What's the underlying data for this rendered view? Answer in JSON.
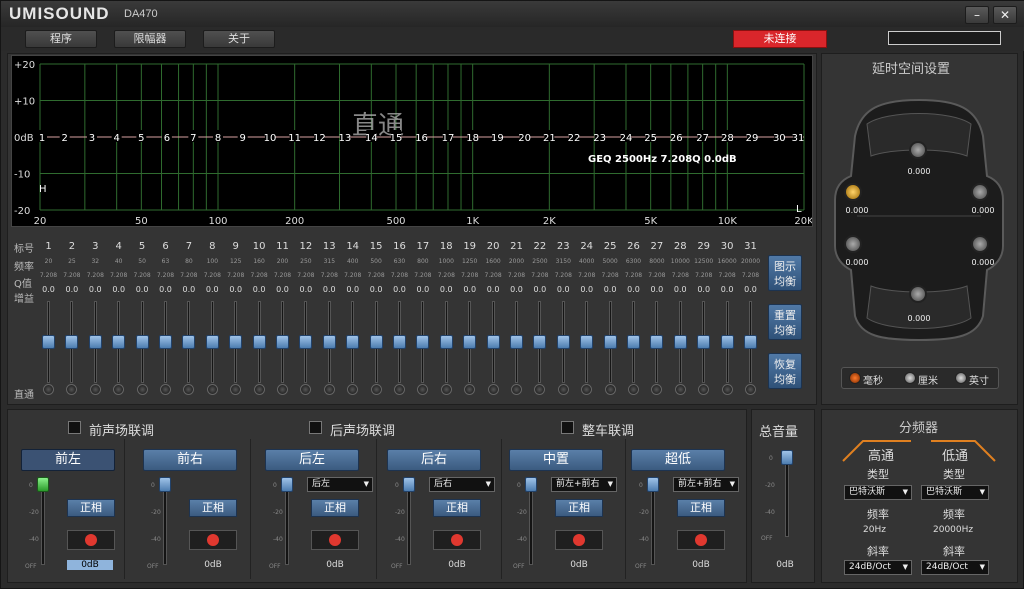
{
  "app": {
    "logo": "UMISOUND",
    "model": "DA470",
    "minimize": "–",
    "close": "✕"
  },
  "menu": [
    "程序",
    "限幅器",
    "关于"
  ],
  "status": {
    "connection": "未连接"
  },
  "graph": {
    "y_labels": [
      "+20",
      "+10",
      "0dB",
      "-10",
      "-20"
    ],
    "x_labels": [
      "20",
      "50",
      "100",
      "200",
      "500",
      "1K",
      "2K",
      "5K",
      "10K",
      "20K"
    ],
    "band_numbers": [
      "1",
      "2",
      "3",
      "4",
      "5",
      "6",
      "7",
      "8",
      "9",
      "10",
      "11",
      "12",
      "13",
      "14",
      "15",
      "16",
      "17",
      "18",
      "19",
      "20",
      "21",
      "22",
      "23",
      "24",
      "25",
      "26",
      "27",
      "28",
      "29",
      "30",
      "31"
    ],
    "mode_text": "直通",
    "info": "GEQ 2500Hz 7.208Q 0.0dB",
    "hp_marker": "H",
    "lp_marker": "L"
  },
  "eq": {
    "row_labels": {
      "index": "标号",
      "freq": "频率",
      "q": "Q值",
      "gain": "增益",
      "bypass": "直通"
    },
    "bands": [
      {
        "n": "1",
        "f": "20",
        "q": "7.208",
        "g": "0.0"
      },
      {
        "n": "2",
        "f": "25",
        "q": "7.208",
        "g": "0.0"
      },
      {
        "n": "3",
        "f": "32",
        "q": "7.208",
        "g": "0.0"
      },
      {
        "n": "4",
        "f": "40",
        "q": "7.208",
        "g": "0.0"
      },
      {
        "n": "5",
        "f": "50",
        "q": "7.208",
        "g": "0.0"
      },
      {
        "n": "6",
        "f": "63",
        "q": "7.208",
        "g": "0.0"
      },
      {
        "n": "7",
        "f": "80",
        "q": "7.208",
        "g": "0.0"
      },
      {
        "n": "8",
        "f": "100",
        "q": "7.208",
        "g": "0.0"
      },
      {
        "n": "9",
        "f": "125",
        "q": "7.208",
        "g": "0.0"
      },
      {
        "n": "10",
        "f": "160",
        "q": "7.208",
        "g": "0.0"
      },
      {
        "n": "11",
        "f": "200",
        "q": "7.208",
        "g": "0.0"
      },
      {
        "n": "12",
        "f": "250",
        "q": "7.208",
        "g": "0.0"
      },
      {
        "n": "13",
        "f": "315",
        "q": "7.208",
        "g": "0.0"
      },
      {
        "n": "14",
        "f": "400",
        "q": "7.208",
        "g": "0.0"
      },
      {
        "n": "15",
        "f": "500",
        "q": "7.208",
        "g": "0.0"
      },
      {
        "n": "16",
        "f": "630",
        "q": "7.208",
        "g": "0.0"
      },
      {
        "n": "17",
        "f": "800",
        "q": "7.208",
        "g": "0.0"
      },
      {
        "n": "18",
        "f": "1000",
        "q": "7.208",
        "g": "0.0"
      },
      {
        "n": "19",
        "f": "1250",
        "q": "7.208",
        "g": "0.0"
      },
      {
        "n": "20",
        "f": "1600",
        "q": "7.208",
        "g": "0.0"
      },
      {
        "n": "21",
        "f": "2000",
        "q": "7.208",
        "g": "0.0"
      },
      {
        "n": "22",
        "f": "2500",
        "q": "7.208",
        "g": "0.0"
      },
      {
        "n": "23",
        "f": "3150",
        "q": "7.208",
        "g": "0.0"
      },
      {
        "n": "24",
        "f": "4000",
        "q": "7.208",
        "g": "0.0"
      },
      {
        "n": "25",
        "f": "5000",
        "q": "7.208",
        "g": "0.0"
      },
      {
        "n": "26",
        "f": "6300",
        "q": "7.208",
        "g": "0.0"
      },
      {
        "n": "27",
        "f": "8000",
        "q": "7.208",
        "g": "0.0"
      },
      {
        "n": "28",
        "f": "10000",
        "q": "7.208",
        "g": "0.0"
      },
      {
        "n": "29",
        "f": "12500",
        "q": "7.208",
        "g": "0.0"
      },
      {
        "n": "30",
        "f": "16000",
        "q": "7.208",
        "g": "0.0"
      },
      {
        "n": "31",
        "f": "20000",
        "q": "7.208",
        "g": "0.0"
      }
    ],
    "buttons": {
      "graphic": "图示\n均衡",
      "reset": "重置\n均衡",
      "restore": "恢复\n均衡"
    }
  },
  "link": {
    "front": "前声场联调",
    "rear": "后声场联调",
    "whole": "整车联调"
  },
  "channels": [
    {
      "name": "前左",
      "phase": "正相",
      "db": "0dB",
      "select": "",
      "active": true
    },
    {
      "name": "前右",
      "phase": "正相",
      "db": "0dB",
      "select": ""
    },
    {
      "name": "后左",
      "phase": "正相",
      "db": "0dB",
      "select": "后左"
    },
    {
      "name": "后右",
      "phase": "正相",
      "db": "0dB",
      "select": "后右"
    },
    {
      "name": "中置",
      "phase": "正相",
      "db": "0dB",
      "select": "前左+前右"
    },
    {
      "name": "超低",
      "phase": "正相",
      "db": "0dB",
      "select": "前左+前右"
    }
  ],
  "fader_ticks": [
    "0",
    "-20",
    "-40",
    "OFF"
  ],
  "master": {
    "title": "总音量",
    "db": "0dB"
  },
  "delay": {
    "title": "延时空间设置",
    "values": {
      "fl": "0.000",
      "fr": "0.000",
      "center": "0.000",
      "rl": "0.000",
      "rr": "0.000",
      "sub": "0.000"
    },
    "units": [
      "毫秒",
      "厘米",
      "英寸"
    ]
  },
  "crossover": {
    "title": "分频器",
    "hp": {
      "title": "高通",
      "type_lbl": "类型",
      "type": "巴特沃斯",
      "freq_lbl": "频率",
      "freq": "20Hz",
      "slope_lbl": "斜率",
      "slope": "24dB/Oct"
    },
    "lp": {
      "title": "低通",
      "type_lbl": "类型",
      "type": "巴特沃斯",
      "freq_lbl": "频率",
      "freq": "20000Hz",
      "slope_lbl": "斜率",
      "slope": "24dB/Oct"
    }
  },
  "colors": {
    "accent": "#4d7db0",
    "grid": "#2f6b2f",
    "connect": "#d9262b",
    "orange": "#e08020"
  }
}
